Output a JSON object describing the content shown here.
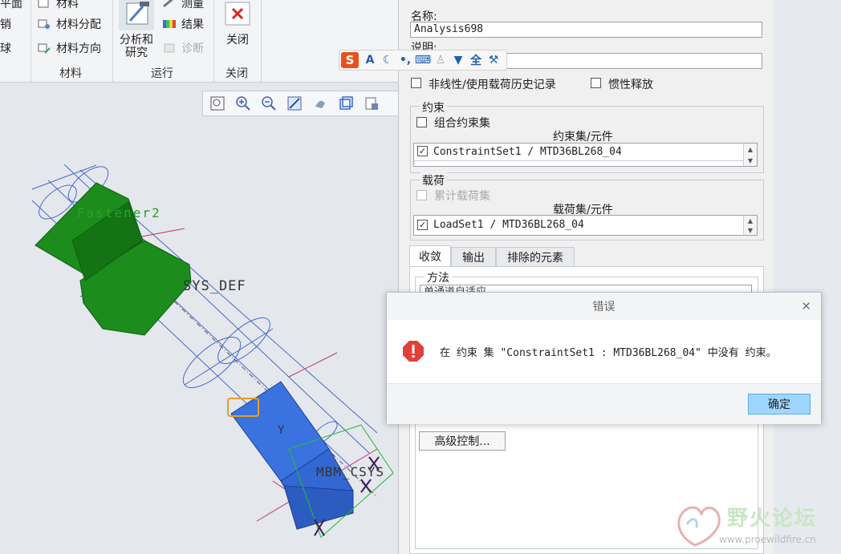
{
  "ribbon": {
    "col1": [
      "平面",
      "销",
      "球"
    ],
    "col2": [
      "材料",
      "材料分配",
      "材料方向"
    ],
    "group_material": "材料",
    "analysis_btn_line1": "分析和",
    "analysis_btn_line2": "研究",
    "col3": [
      "测量",
      "结果",
      "诊断"
    ],
    "group_run": "运行",
    "close_btn": "关闭",
    "group_close": "关闭"
  },
  "model_labels": {
    "fastener": "Fastener2",
    "csys": "SYS_DEF",
    "y_axis": "Y",
    "part_csys": "MBM_CSYS"
  },
  "dialog": {
    "name_label": "名称:",
    "name_value": "Analysis698",
    "desc_label": "说明:",
    "desc_value": "",
    "nonlinear_label": "非线性/使用载荷历史记录",
    "inertia_label": "惯性释放",
    "constraint_group": "约束",
    "combine_constraints": "组合约束集",
    "constraint_col_header": "约束集/元件",
    "constraint_row": "ConstraintSet1 / MTD36BL268_04",
    "load_group": "载荷",
    "accumulate_loads": "累计载荷集",
    "load_col_header": "载荷集/元件",
    "load_row": "LoadSet1 / MTD36BL268_04",
    "tabs": [
      "收敛",
      "输出",
      "排除的元素"
    ],
    "method_label": "方法",
    "method_value": "单通道自适应",
    "advanced_btn": "高级控制..."
  },
  "error_dialog": {
    "title": "错误",
    "message": "在 约束 集 \"ConstraintSet1 : MTD36BL268_04\" 中没有 约束。",
    "ok": "确定"
  },
  "watermark": {
    "title": "野火论坛",
    "url": "www.proewildfire.cn"
  },
  "colors": {
    "accent": "#9fd6ff",
    "fastener_green": "#1c8c1c",
    "part_blue": "#3a73e0",
    "error_red": "#e0403a"
  }
}
